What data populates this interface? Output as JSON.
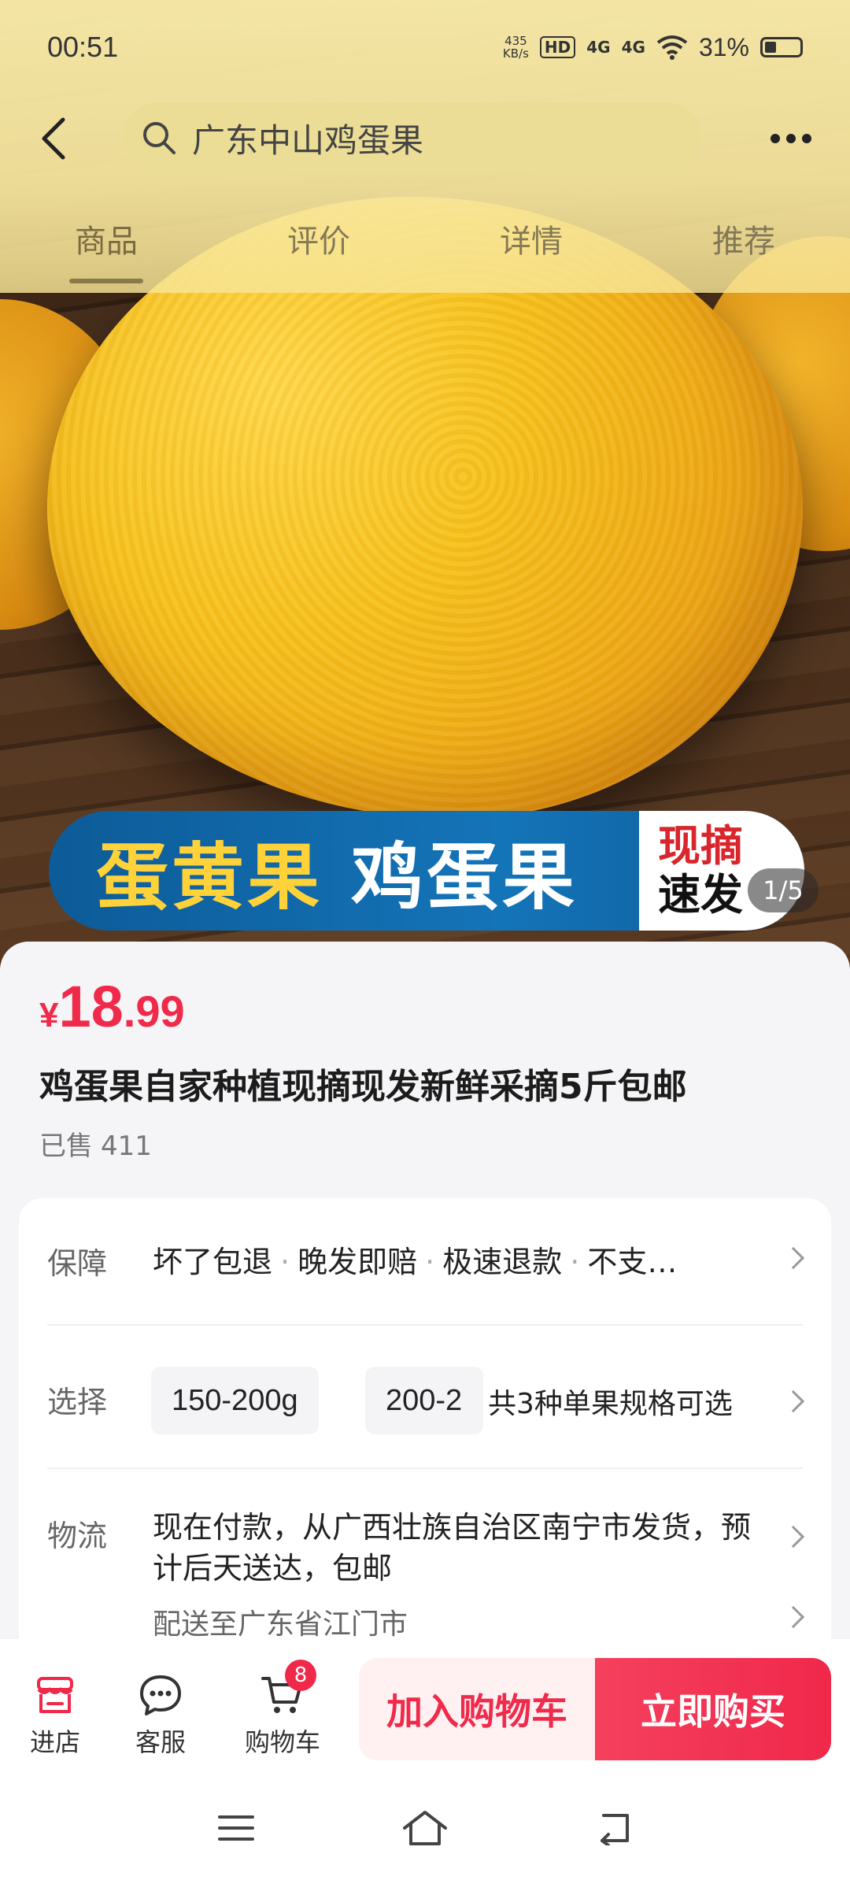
{
  "status_bar": {
    "time": "00:51",
    "net_speed": "435",
    "net_unit": "KB/s",
    "hd_tag": "HD",
    "signal1": "4G",
    "signal2": "4G",
    "battery": "31%"
  },
  "header": {
    "search_query": "广东中山鸡蛋果",
    "tabs": [
      {
        "label": "商品",
        "active": true
      },
      {
        "label": "评价",
        "active": false
      },
      {
        "label": "详情",
        "active": false
      },
      {
        "label": "推荐",
        "active": false
      }
    ]
  },
  "hero": {
    "banner_text_yellow": "蛋黄果",
    "banner_text_white": "鸡蛋果",
    "banner_tag_top": "现摘",
    "banner_tag_bottom": "速发",
    "image_counter": "1/5"
  },
  "product": {
    "currency": "¥",
    "price_int": "18",
    "price_dec": ".99",
    "title": "鸡蛋果自家种植现摘现发新鲜采摘5斤包邮",
    "sold_label": "已售",
    "sold_count": "411"
  },
  "guarantee": {
    "label": "保障",
    "items": [
      "坏了包退",
      "晚发即赔",
      "极速退款",
      "不支…"
    ]
  },
  "select": {
    "label": "选择",
    "options": [
      "150-200g",
      "200-2"
    ],
    "summary": "共3种单果规格可选"
  },
  "logistics": {
    "label": "物流",
    "text": "现在付款，从广西壮族自治区南宁市发货，预计后天送达，包邮",
    "ship_to": "配送至广东省江门市"
  },
  "bottom_bar": {
    "shop": "进店",
    "service": "客服",
    "cart": "购物车",
    "cart_badge": "8",
    "add_to_cart": "加入购物车",
    "buy_now": "立即购买"
  },
  "colors": {
    "accent": "#f02a4a",
    "header_tint": "#f8e8a0",
    "banner_blue": "#1474b8"
  }
}
